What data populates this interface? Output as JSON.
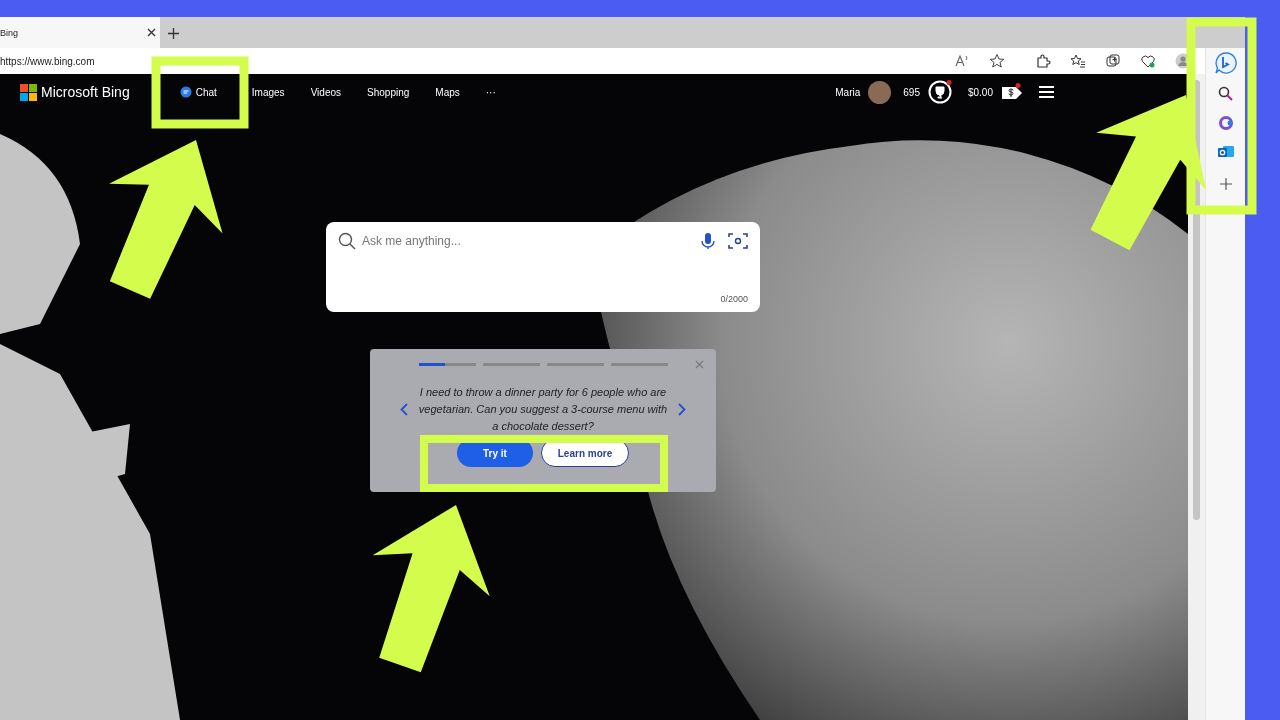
{
  "tab": {
    "title": "Bing",
    "selected": true
  },
  "address_bar": {
    "url": "https://www.bing.com"
  },
  "nav": {
    "logo": "Microsoft Bing",
    "links": [
      {
        "label": "Chat",
        "kind": "chat"
      },
      {
        "label": "Images",
        "kind": "text"
      },
      {
        "label": "Videos",
        "kind": "text"
      },
      {
        "label": "Shopping",
        "kind": "text"
      },
      {
        "label": "Maps",
        "kind": "text"
      },
      {
        "label": "···",
        "kind": "text"
      }
    ],
    "user_name": "Maria",
    "points": "695",
    "balance": "$0.00"
  },
  "search": {
    "placeholder": "Ask me anything...",
    "counter": "0/2000"
  },
  "carousel": {
    "steps": [
      {
        "selected": true
      },
      {
        "selected": false
      },
      {
        "selected": false
      },
      {
        "selected": false
      }
    ],
    "prompt": "I need to throw a dinner party for 6 people who are vegetarian. Can you suggest a 3-course menu with a chocolate dessert?",
    "buttons": [
      {
        "label": "Try it",
        "kind": "primary"
      },
      {
        "label": "Learn more",
        "kind": "secondary"
      }
    ]
  }
}
